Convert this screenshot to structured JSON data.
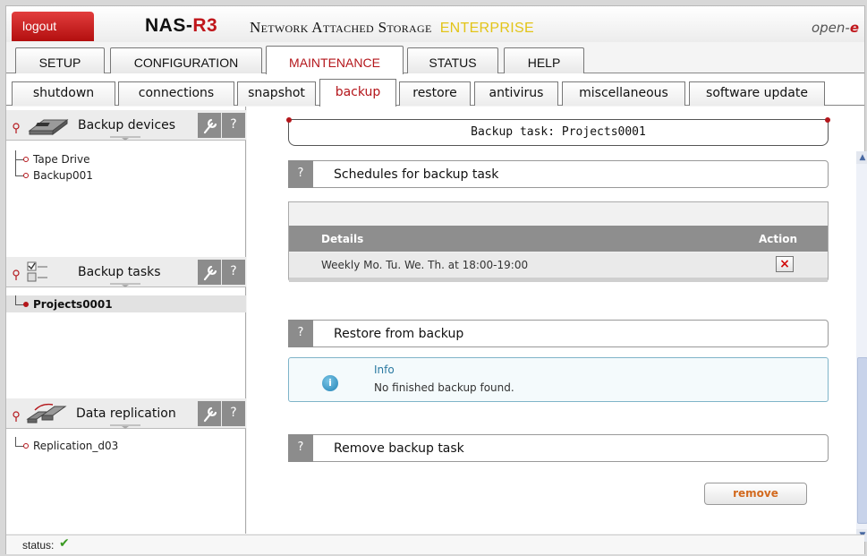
{
  "header": {
    "logout_label": "logout",
    "brand_prefix": "NAS-",
    "brand_suffix": "R3",
    "subtitle": "Network Attached Storage",
    "edition": "ENTERPRISE",
    "vendor_logo_prefix": "open-",
    "vendor_logo_suffix": "e"
  },
  "main_tabs": [
    "SETUP",
    "CONFIGURATION",
    "MAINTENANCE",
    "STATUS",
    "HELP"
  ],
  "main_active": "MAINTENANCE",
  "sub_tabs": [
    "shutdown",
    "connections",
    "snapshot",
    "backup",
    "restore",
    "antivirus",
    "miscellaneous",
    "software update"
  ],
  "sub_active": "backup",
  "sidebar": {
    "sections": [
      {
        "title": "Backup devices",
        "icon": "tape-drive-icon",
        "items": [
          "Tape Drive",
          "Backup001"
        ]
      },
      {
        "title": "Backup tasks",
        "icon": "task-list-icon",
        "items": [
          "Projects0001"
        ],
        "selected": "Projects0001"
      },
      {
        "title": "Data replication",
        "icon": "replication-icon",
        "items": [
          "Replication_d03"
        ]
      }
    ],
    "help_label": "?"
  },
  "main": {
    "task_title": "Backup task: Projects0001",
    "schedules_title": "Schedules for backup task",
    "schedules_table": {
      "columns": [
        "Details",
        "Action"
      ],
      "rows": [
        {
          "details": "Weekly Mo. Tu. We. Th. at 18:00-19:00",
          "action": "×"
        }
      ]
    },
    "restore_title": "Restore from backup",
    "info_title": "Info",
    "info_text": "No finished backup found.",
    "remove_title": "Remove backup task",
    "remove_button": "remove",
    "help_label": "?"
  },
  "status": {
    "label": "status:",
    "icon": "check-icon",
    "value": "✔"
  },
  "colors": {
    "accent_red": "#b4161b",
    "edition_yellow": "#e2c418",
    "panel_gray": "#8c8c8c",
    "info_blue": "#2a79a1",
    "ok_green": "#3a9a22"
  }
}
